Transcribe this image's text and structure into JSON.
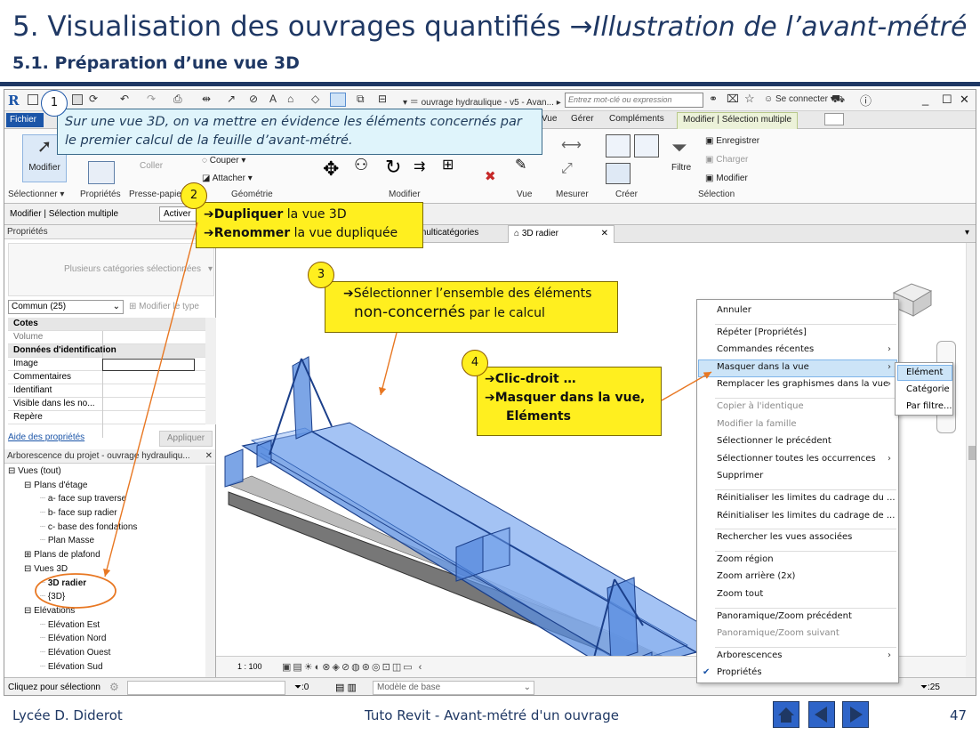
{
  "slide": {
    "title_main": "5. Visualisation des ouvrages quantifiés ",
    "title_arrow": "→",
    "title_italic": "Illustration de l’avant-métré",
    "subtitle": "5.1. Préparation d’une vue 3D",
    "footer_left": "Lycée D. Diderot",
    "footer_center": "Tuto Revit - Avant-métré d'un ouvrage",
    "page_number": "47"
  },
  "app": {
    "logo": "R",
    "doc_title": "ouvrage hydraulique - v5 - Avan...",
    "search_placeholder": "Entrez mot-clé ou expression",
    "sign_in": "Se connecter",
    "tabs": [
      "Fichier",
      "Vue",
      "Gérer",
      "Compléments",
      "Modifier | Sélection multiple"
    ],
    "ribbon": {
      "modifier": "Modifier",
      "coller": "Coller",
      "couper": "Couper",
      "attacher": "Attacher",
      "filtre": "Filtre",
      "enregistrer": "Enregistrer",
      "charger": "Charger",
      "modifier_sel": "Modifier",
      "groups": [
        "Sélectionner ▾",
        "Propriétés",
        "Presse-papie",
        "Géométrie",
        "Modifier",
        "Vue",
        "Mesurer",
        "Créer",
        "Sélection"
      ]
    },
    "modbar": {
      "label": "Modifier | Sélection multiple",
      "activer": "Activer"
    },
    "properties": {
      "header": "Propriétés",
      "type_selector": "Plusieurs catégories sélectionnées",
      "filter": "Commun (25)",
      "edit_type": "Modifier le type",
      "rows": [
        {
          "label": "Cotes",
          "group": true
        },
        {
          "label": "Volume",
          "group": false
        },
        {
          "label": "Données d'identification",
          "group": true
        },
        {
          "label": "Image",
          "group": false
        },
        {
          "label": "Commentaires",
          "group": false
        },
        {
          "label": "Identifiant",
          "group": false
        },
        {
          "label": "Visible dans les no...",
          "group": false
        },
        {
          "label": "Repère",
          "group": false
        }
      ],
      "help_link": "Aide des propriétés",
      "apply": "Appliquer"
    },
    "browser": {
      "header": "Arborescence du projet - ouvrage hydrauliqu...",
      "items": [
        {
          "label": "Vues (tout)",
          "indent": 0,
          "toggle": "⊟"
        },
        {
          "label": "Plans d'étage",
          "indent": 1,
          "toggle": "⊟"
        },
        {
          "label": "a- face sup traverse",
          "indent": 2,
          "toggle": ""
        },
        {
          "label": "b- face sup radier",
          "indent": 2,
          "toggle": ""
        },
        {
          "label": "c- base des fondations",
          "indent": 2,
          "toggle": ""
        },
        {
          "label": "Plan Masse",
          "indent": 2,
          "toggle": ""
        },
        {
          "label": "Plans de plafond",
          "indent": 1,
          "toggle": "⊞"
        },
        {
          "label": "Vues 3D",
          "indent": 1,
          "toggle": "⊟"
        },
        {
          "label": "3D radier",
          "indent": 2,
          "toggle": "",
          "bold": true
        },
        {
          "label": "{3D}",
          "indent": 2,
          "toggle": ""
        },
        {
          "label": "Elévations",
          "indent": 1,
          "toggle": "⊟"
        },
        {
          "label": "Elévation Est",
          "indent": 2,
          "toggle": ""
        },
        {
          "label": "Elévation Nord",
          "indent": 2,
          "toggle": ""
        },
        {
          "label": "Elévation Ouest",
          "indent": 2,
          "toggle": ""
        },
        {
          "label": "Elévation Sud",
          "indent": 2,
          "toggle": ""
        }
      ]
    },
    "view_tabs": [
      "multicatégories",
      "3D radier"
    ],
    "view_scale": "1 : 100",
    "status": {
      "left": "Cliquez pour sélectionn",
      "filter_count": ":0",
      "model": "Modèle de base",
      "right_count": ":25"
    },
    "context_menu": [
      {
        "label": "Annuler",
        "disabled": false,
        "arrow": false
      },
      {
        "label": "Répéter [Propriétés]",
        "disabled": false,
        "arrow": false
      },
      {
        "label": "Commandes récentes",
        "disabled": false,
        "arrow": true
      },
      {
        "label": "Masquer dans la vue",
        "disabled": false,
        "arrow": true,
        "highlight": true
      },
      {
        "label": "Remplacer les graphismes dans la vue",
        "disabled": false,
        "arrow": true
      },
      {
        "label": "Copier à l'identique",
        "disabled": true,
        "arrow": false
      },
      {
        "label": "Modifier la famille",
        "disabled": true,
        "arrow": false
      },
      {
        "label": "Sélectionner le précédent",
        "disabled": false,
        "arrow": false
      },
      {
        "label": "Sélectionner toutes les occurrences",
        "disabled": false,
        "arrow": true
      },
      {
        "label": "Supprimer",
        "disabled": false,
        "arrow": false
      },
      {
        "label": "Réinitialiser les limites du cadrage du ...",
        "disabled": false,
        "arrow": false
      },
      {
        "label": "Réinitialiser les limites du cadrage de ...",
        "disabled": false,
        "arrow": false
      },
      {
        "label": "Rechercher les vues associées",
        "disabled": false,
        "arrow": false
      },
      {
        "label": "Zoom région",
        "disabled": false,
        "arrow": false
      },
      {
        "label": "Zoom arrière (2x)",
        "disabled": false,
        "arrow": false
      },
      {
        "label": "Zoom tout",
        "disabled": false,
        "arrow": false
      },
      {
        "label": "Panoramique/Zoom précédent",
        "disabled": false,
        "arrow": false
      },
      {
        "label": "Panoramique/Zoom suivant",
        "disabled": true,
        "arrow": false
      },
      {
        "label": "Arborescences",
        "disabled": false,
        "arrow": true
      },
      {
        "label": "Propriétés",
        "disabled": false,
        "arrow": false,
        "checked": true
      }
    ],
    "submenu": [
      "Elément",
      "Catégorie",
      "Par filtre..."
    ]
  },
  "callouts": {
    "step1": {
      "num": "1",
      "text_line1": "Sur une vue 3D, on va mettre en évidence les éléments concernés par",
      "text_line2": "le premier calcul de la feuille d’avant-métré."
    },
    "step2": {
      "num": "2",
      "bold1": "Dupliquer",
      "rest1": " la vue 3D",
      "bold2": "Renommer",
      "rest2": " la vue dupliquée"
    },
    "step3": {
      "num": "3",
      "line1": "Sélectionner l’ensemble des éléments",
      "line2_big": "non-concernés",
      "line2_rest": " par le calcul"
    },
    "step4": {
      "num": "4",
      "line1": "Clic-droit …",
      "line2": "Masquer dans la vue,",
      "line3": "Eléments"
    }
  },
  "colors": {
    "accent": "#1b55a8",
    "callout_yellow": "#ffef1f",
    "callout_blue": "#dff4fb",
    "slide_text": "#1f3864",
    "arrow": "#e87722"
  }
}
